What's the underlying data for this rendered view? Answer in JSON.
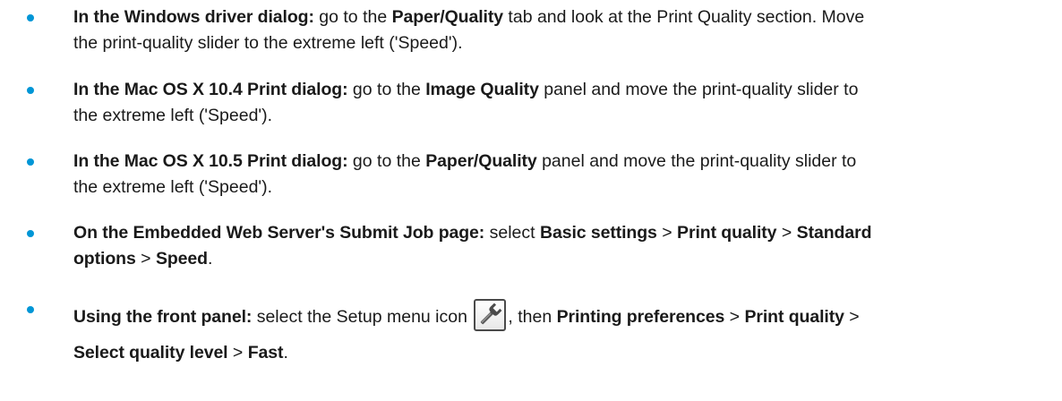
{
  "items": [
    {
      "lead": "In the Windows driver dialog:",
      "t1": " go to the ",
      "b1": "Paper/Quality",
      "t2": " tab and look at the Print Quality section. Move",
      "line2": "the print-quality slider to the extreme left ('Speed')."
    },
    {
      "lead": "In the Mac OS X 10.4 Print dialog:",
      "t1": " go to the ",
      "b1": "Image Quality",
      "t2": " panel and move the print-quality slider to",
      "line2": "the extreme left ('Speed')."
    },
    {
      "lead": "In the Mac OS X 10.5 Print dialog:",
      "t1": " go to the ",
      "b1": "Paper/Quality",
      "t2": " panel and move the print-quality slider to",
      "line2": "the extreme left ('Speed')."
    },
    {
      "lead": "On the Embedded Web Server's Submit Job page:",
      "t1": " select ",
      "b1": "Basic settings",
      "sep1": " > ",
      "b2": "Print quality",
      "sep2": " > ",
      "b3": "Standard",
      "b4": "options",
      "sep3": " > ",
      "b5": "Speed",
      "end": "."
    },
    {
      "lead": "Using the front panel:",
      "t1": " select the Setup menu icon ",
      "icon": "wrench-icon",
      "t2": ", then ",
      "b1": "Printing preferences",
      "sep1": " > ",
      "b2": "Print quality",
      "sep2": " >",
      "b3": "Select quality level",
      "sep3": " > ",
      "b4": "Fast",
      "end": "."
    }
  ],
  "colors": {
    "bullet": "#0096d6",
    "text": "#1a1a1a"
  }
}
